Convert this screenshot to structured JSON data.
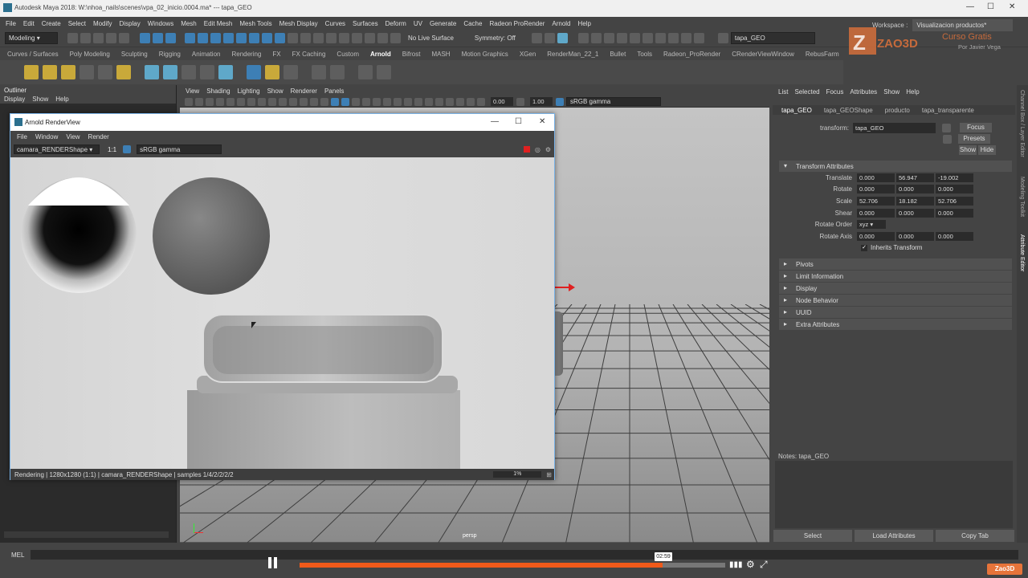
{
  "window": {
    "title": "Autodesk Maya 2018: W:\\nhoa_nails\\scenes\\vpa_02_inicio.0004.ma*   ---   tapa_GEO"
  },
  "menubar": [
    "File",
    "Edit",
    "Create",
    "Select",
    "Modify",
    "Display",
    "Windows",
    "Mesh",
    "Edit Mesh",
    "Mesh Tools",
    "Mesh Display",
    "Curves",
    "Surfaces",
    "Deform",
    "UV",
    "Generate",
    "Cache",
    "Radeon ProRender",
    "Arnold",
    "Help"
  ],
  "statusline": {
    "mode": "Modeling",
    "live_surface": "No Live Surface",
    "symmetry": "Symmetry: Off",
    "object_name": "tapa_GEO",
    "workspace_label": "Workspace :",
    "workspace_value": "Visualizacion productos*"
  },
  "shelf_tabs": [
    "Curves / Surfaces",
    "Poly Modeling",
    "Sculpting",
    "Rigging",
    "Animation",
    "Rendering",
    "FX",
    "FX Caching",
    "Custom",
    "Arnold",
    "Bifrost",
    "MASH",
    "Motion Graphics",
    "XGen",
    "RenderMan_22_1",
    "Bullet",
    "Tools",
    "Radeon_ProRender",
    "CRenderViewWindow",
    "RebusFarm"
  ],
  "shelf_active": "Arnold",
  "outliner": {
    "title": "Outliner",
    "menus": [
      "Display",
      "Show",
      "Help"
    ]
  },
  "viewport": {
    "menus": [
      "View",
      "Shading",
      "Lighting",
      "Show",
      "Renderer",
      "Panels"
    ],
    "value_a": "0.00",
    "value_b": "1.00",
    "color_space": "sRGB gamma",
    "camera_label": "persp"
  },
  "renderview": {
    "title": "Arnold RenderView",
    "menus": [
      "File",
      "Window",
      "View",
      "Render"
    ],
    "camera": "camara_RENDERShape",
    "ratio": "1:1",
    "color_space": "sRGB gamma",
    "status": "Rendering | 1280x1280 (1:1) | camara_RENDERShape | samples 1/4/2/2/2/2",
    "progress": "1%"
  },
  "attribute_editor": {
    "menus": [
      "List",
      "Selected",
      "Focus",
      "Attributes",
      "Show",
      "Help"
    ],
    "tabs": [
      "tapa_GEO",
      "tapa_GEOShape",
      "producto",
      "tapa_transparente"
    ],
    "transform_label": "transform:",
    "transform_value": "tapa_GEO",
    "focus": "Focus",
    "presets": "Presets",
    "show": "Show",
    "hide": "Hide",
    "section_open": "Transform Attributes",
    "attrs": [
      {
        "label": "Translate",
        "v": [
          "0.000",
          "56.947",
          "-19.002"
        ]
      },
      {
        "label": "Rotate",
        "v": [
          "0.000",
          "0.000",
          "0.000"
        ]
      },
      {
        "label": "Scale",
        "v": [
          "52.706",
          "18.182",
          "52.706"
        ]
      },
      {
        "label": "Shear",
        "v": [
          "0.000",
          "0.000",
          "0.000"
        ]
      }
    ],
    "rotate_order_label": "Rotate Order",
    "rotate_order": "xyz",
    "rotate_axis_label": "Rotate Axis",
    "rotate_axis": [
      "0.000",
      "0.000",
      "0.000"
    ],
    "inherits": "Inherits Transform",
    "sections": [
      "Pivots",
      "Limit Information",
      "Display",
      "Node Behavior",
      "UUID",
      "Extra Attributes"
    ],
    "notes": "Notes:  tapa_GEO",
    "buttons": [
      "Select",
      "Load Attributes",
      "Copy Tab"
    ]
  },
  "side_tabs": [
    "Channel Box / Layer Editor",
    "Modeling Toolkit",
    "Attribute Editor"
  ],
  "cmdline": {
    "label": "MEL"
  },
  "player": {
    "timecode": "02:59",
    "progress": 0.853
  },
  "watermark": {
    "brand": "ZAO3D",
    "text": "Curso Gratis",
    "author": "Por Javier Vega",
    "badge": "Zao3D"
  }
}
